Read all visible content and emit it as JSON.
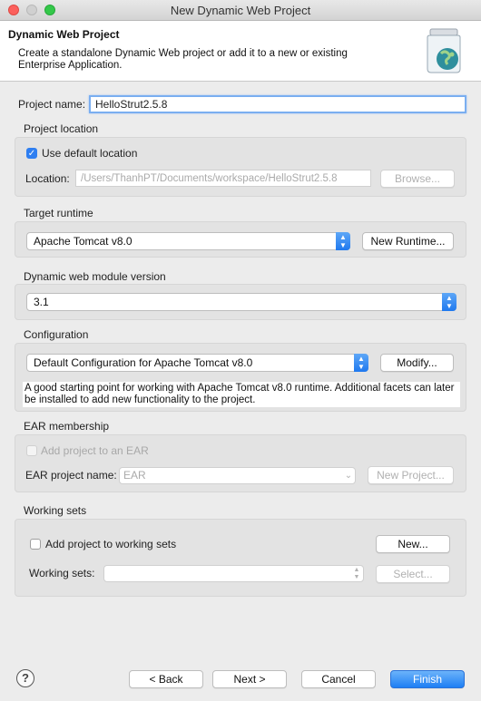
{
  "window": {
    "title": "New Dynamic Web Project"
  },
  "header": {
    "title": "Dynamic Web Project",
    "description": "Create a standalone Dynamic Web project or add it to a new or existing Enterprise Application.",
    "icon": "jar-globe-icon"
  },
  "project": {
    "name_label": "Project name:",
    "name_value": "HelloStrut2.5.8"
  },
  "location": {
    "group_title": "Project location",
    "use_default_label": "Use default location",
    "use_default_checked": true,
    "location_label": "Location:",
    "location_value": "/Users/ThanhPT/Documents/workspace/HelloStrut2.5.8",
    "browse_label": "Browse..."
  },
  "runtime": {
    "group_title": "Target runtime",
    "selected": "Apache Tomcat v8.0",
    "new_runtime_label": "New Runtime..."
  },
  "module": {
    "group_title": "Dynamic web module version",
    "selected": "3.1"
  },
  "configuration": {
    "group_title": "Configuration",
    "selected": "Default Configuration for Apache Tomcat v8.0",
    "modify_label": "Modify...",
    "description": "A good starting point for working with Apache Tomcat v8.0 runtime. Additional facets can later be installed to add new functionality to the project."
  },
  "ear": {
    "group_title": "EAR membership",
    "add_label": "Add project to an EAR",
    "project_name_label": "EAR project name:",
    "project_name_value": "EAR",
    "new_project_label": "New Project..."
  },
  "working_sets": {
    "group_title": "Working sets",
    "add_label": "Add project to working sets",
    "new_label": "New...",
    "sets_label": "Working sets:",
    "select_label": "Select..."
  },
  "footer": {
    "help_label": "?",
    "back_label": "< Back",
    "next_label": "Next >",
    "cancel_label": "Cancel",
    "finish_label": "Finish"
  },
  "colors": {
    "accent": "#1e7ff4",
    "panel": "#e3e3e3",
    "window": "#ececec"
  }
}
